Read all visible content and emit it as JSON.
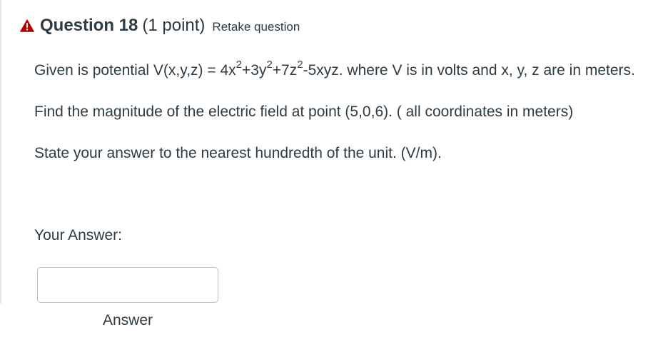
{
  "question": {
    "title": "Question 18",
    "points": "(1 point)",
    "retake_label": "Retake question",
    "warning_icon": "warning-triangle-icon",
    "warning_color": "#b00000"
  },
  "body": {
    "line1_prefix": "Given is potential V(x,y,z) = 4x",
    "sup1": "2",
    "mid1": "+3y",
    "sup2": "2",
    "mid2": "+7z",
    "sup3": "2",
    "line1_suffix": "-5xyz. where V is in volts and x, y, z are in meters.",
    "paragraph2": "Find the magnitude of the electric field at point (5,0,6). ( all coordinates in meters)",
    "paragraph3": "State your answer to the nearest hundredth of the unit. (V/m)."
  },
  "answer": {
    "label": "Your Answer:",
    "input_value": "",
    "input_placeholder": "",
    "caption": "Answer"
  }
}
